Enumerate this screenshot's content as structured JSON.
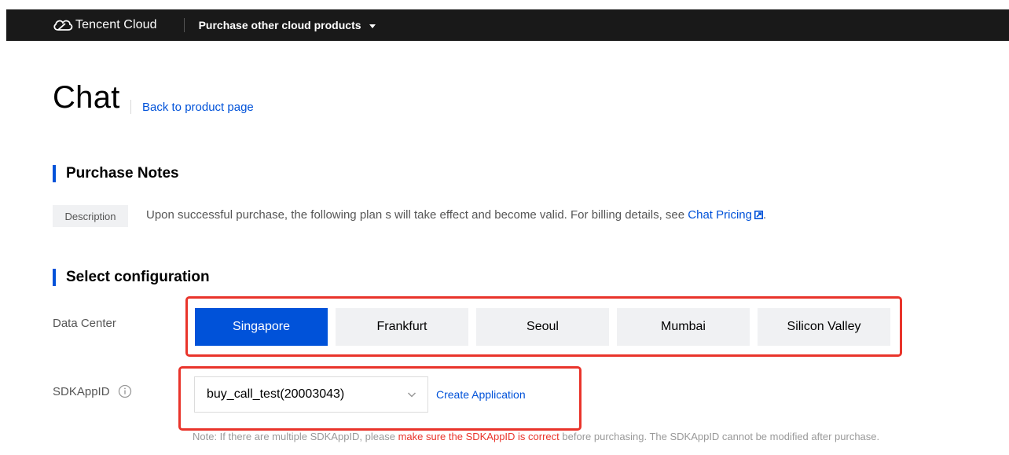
{
  "topbar": {
    "brand": "Tencent Cloud",
    "menu_label": "Purchase other cloud products"
  },
  "page": {
    "title": "Chat",
    "back_link": "Back to product page"
  },
  "purchase_notes": {
    "heading": "Purchase Notes",
    "tag": "Description",
    "text": "Upon successful purchase, the following plan s will take effect and become valid. For billing details, see ",
    "link": "Chat Pricing",
    "suffix": "."
  },
  "config": {
    "heading": "Select configuration",
    "data_center": {
      "label": "Data Center",
      "options": [
        "Singapore",
        "Frankfurt",
        "Seoul",
        "Mumbai",
        "Silicon Valley"
      ],
      "selected": "Singapore"
    },
    "sdkappid": {
      "label": "SDKAppID",
      "value": "buy_call_test(20003043)",
      "create_link": "Create Application",
      "note_pre": "Note: If there are multiple SDKAppID, please ",
      "note_warn": "make sure the SDKAppID is correct",
      "note_post": " before purchasing. The SDKAppID cannot be modified after purchase."
    }
  },
  "colors": {
    "accent": "#0052d9",
    "highlight": "#e9342b",
    "topbar": "#191919"
  },
  "icons": [
    "tencent-cloud-logo-icon",
    "caret-down-icon",
    "external-link-icon",
    "info-icon",
    "chevron-down-icon"
  ]
}
